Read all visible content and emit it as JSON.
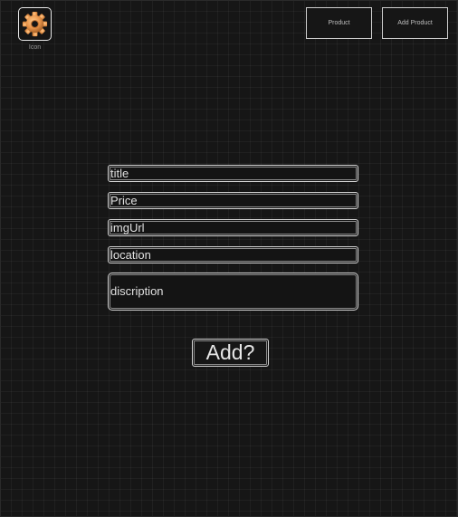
{
  "header": {
    "logo": {
      "icon": "gear-icon",
      "caption": "Icon",
      "color": "#e8944a"
    },
    "nav": {
      "product_label": "Product",
      "add_product_label": "Add Product"
    }
  },
  "form": {
    "title": {
      "placeholder": "title",
      "value": ""
    },
    "price": {
      "placeholder": "Price",
      "value": ""
    },
    "img_url": {
      "placeholder": "imgUrl",
      "value": ""
    },
    "location": {
      "placeholder": "location",
      "value": ""
    },
    "description": {
      "placeholder": "discription",
      "value": ""
    },
    "submit_label": "Add?"
  }
}
